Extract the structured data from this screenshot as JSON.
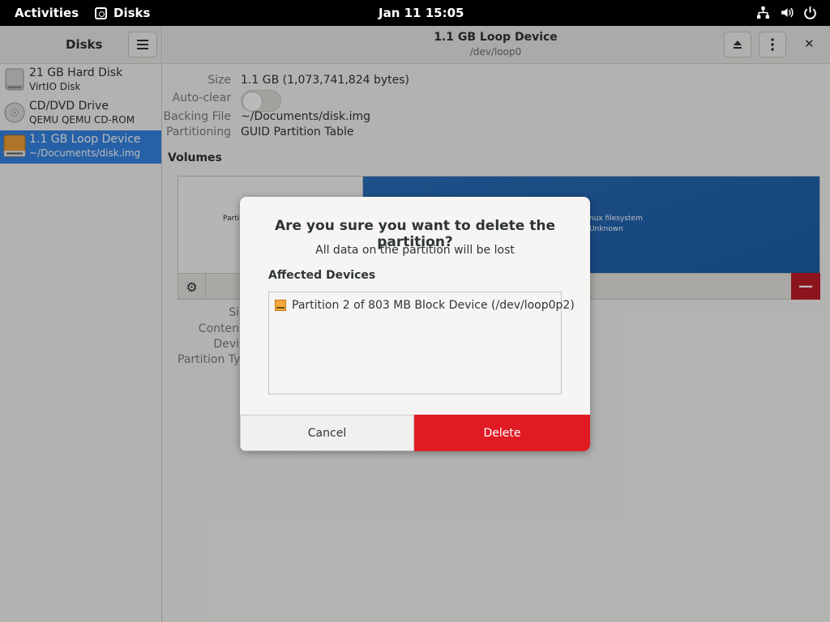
{
  "topbar": {
    "activities": "Activities",
    "app_name": "Disks",
    "clock": "Jan 11  15:05",
    "tray_icons": [
      "network-icon",
      "volume-icon",
      "power-icon"
    ]
  },
  "sidebar": {
    "title": "Disks",
    "disks": [
      {
        "name": "21 GB Hard Disk",
        "sub": "VirtIO Disk",
        "icon": "harddisk-icon"
      },
      {
        "name": "CD/DVD Drive",
        "sub": "QEMU QEMU CD-ROM",
        "icon": "optical-drive-icon"
      },
      {
        "name": "1.1 GB Loop Device",
        "sub": "~/Documents/disk.img",
        "icon": "loop-device-icon"
      }
    ]
  },
  "header": {
    "title": "1.1 GB Loop Device",
    "subtitle": "/dev/loop0"
  },
  "properties": {
    "size_label": "Size",
    "size_value": "1.1 GB (1,073,741,824 bytes)",
    "autoclear_label": "Auto-clear",
    "backing_label": "Backing File",
    "backing_value": "~/Documents/disk.img",
    "partitioning_label": "Partitioning",
    "partitioning_value": "GUID Partition Table"
  },
  "volumes": {
    "title": "Volumes",
    "part1_label": "Parti",
    "part2_line1": "nux filesystem",
    "part2_line2": "Unknown"
  },
  "details": {
    "size": "Si",
    "contents": "Conten",
    "device": "Devi",
    "partition_type": "Partition Typ"
  },
  "dialog": {
    "title": "Are you sure you want to delete the partition?",
    "message": "All data on the partition will be lost",
    "affected_label": "Affected Devices",
    "affected_items": [
      "Partition 2 of 803 MB Block Device (/dev/loop0p2)"
    ],
    "cancel_label": "Cancel",
    "delete_label": "Delete"
  },
  "colors": {
    "accent": "#3584e4",
    "destructive": "#e01b24",
    "partition_blue": "#1c5fa8"
  }
}
